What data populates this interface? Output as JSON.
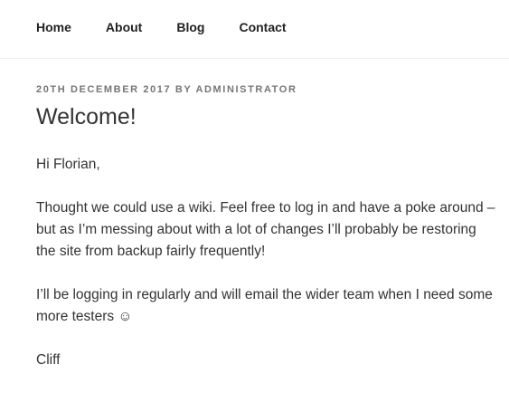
{
  "nav": {
    "items": [
      "Home",
      "About",
      "Blog",
      "Contact"
    ]
  },
  "post": {
    "meta": {
      "date": "20th December 2017",
      "by": "by",
      "author": "Administrator"
    },
    "title": "Welcome!",
    "paragraphs": [
      "Hi Florian,",
      "Thought we could use a wiki.  Feel free to log in and have a poke around – but as I’m messing about with a lot of changes I’ll probably be restoring the site from backup fairly frequently!",
      "I’ll be logging in regularly and will email the wider team when I need some more testers ☺",
      "Cliff"
    ]
  }
}
